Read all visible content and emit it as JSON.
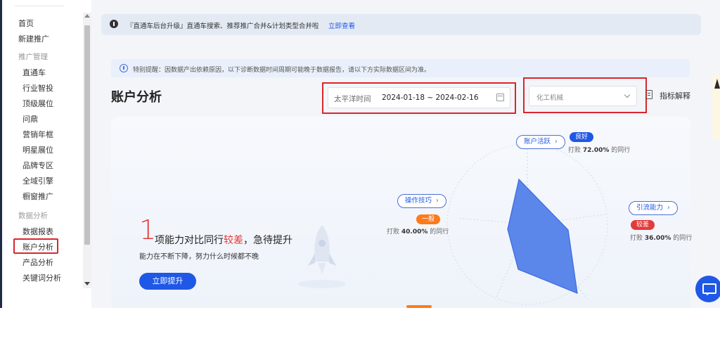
{
  "sidebar": {
    "items": [
      {
        "label": "首页",
        "type": "item"
      },
      {
        "label": "新建推广",
        "type": "item"
      },
      {
        "label": "推广管理",
        "type": "group"
      },
      {
        "label": "直通车",
        "type": "sub"
      },
      {
        "label": "行业智投",
        "type": "sub"
      },
      {
        "label": "顶级展位",
        "type": "sub"
      },
      {
        "label": "问鼎",
        "type": "sub"
      },
      {
        "label": "营销年框",
        "type": "sub"
      },
      {
        "label": "明星展位",
        "type": "sub"
      },
      {
        "label": "品牌专区",
        "type": "sub"
      },
      {
        "label": "全域引擎",
        "type": "sub"
      },
      {
        "label": "橱窗推广",
        "type": "sub"
      },
      {
        "label": "数据分析",
        "type": "group"
      },
      {
        "label": "数据报表",
        "type": "sub"
      },
      {
        "label": "账户分析",
        "type": "sub",
        "active": true
      },
      {
        "label": "产品分析",
        "type": "sub"
      },
      {
        "label": "关键词分析",
        "type": "sub"
      }
    ]
  },
  "banner": {
    "text": "『直通车后台升级』直通车搜索、推荐推广合并&计划类型合并啦",
    "link": "立即查看"
  },
  "notice": {
    "text": "特别提醒：因数据产出依赖原因，以下诊断数据时间周期可能晚于数据报告，请以下方实际数据区间为准。"
  },
  "page": {
    "title": "账户分析"
  },
  "date_picker": {
    "timezone": "太平洋时间",
    "range": "2024-01-18 ~ 2024-02-16"
  },
  "industry_select": {
    "value": "化工机械"
  },
  "metric_explain": {
    "label": "指标解释"
  },
  "summary": {
    "count": "1",
    "headline_pre": "项能力对比同行",
    "headline_em": "较差",
    "headline_post": "，急待提升",
    "subline": "能力在不断下降，努力什么时候都不晚",
    "cta": "立即提升"
  },
  "radar": {
    "axes": [
      {
        "name": "账户活跃",
        "status": "良好",
        "status_color": "#1f58e6",
        "beat_pre": "打败",
        "beat_pct": "72.00%",
        "beat_post": "的同行"
      },
      {
        "name": "操作技巧",
        "status": "一般",
        "status_color": "#ff7a1a",
        "beat_pre": "打败",
        "beat_pct": "40.00%",
        "beat_post": "的同行"
      },
      {
        "name": "引流能力",
        "status": "较差",
        "status_color": "#e33b3b",
        "beat_pre": "打败",
        "beat_pct": "36.00%",
        "beat_post": "的同行"
      }
    ]
  },
  "colors": {
    "accent": "#1f58e6",
    "danger": "#e33b3b",
    "warning": "#ff7a1a",
    "highlight_box": "#d9262c"
  }
}
